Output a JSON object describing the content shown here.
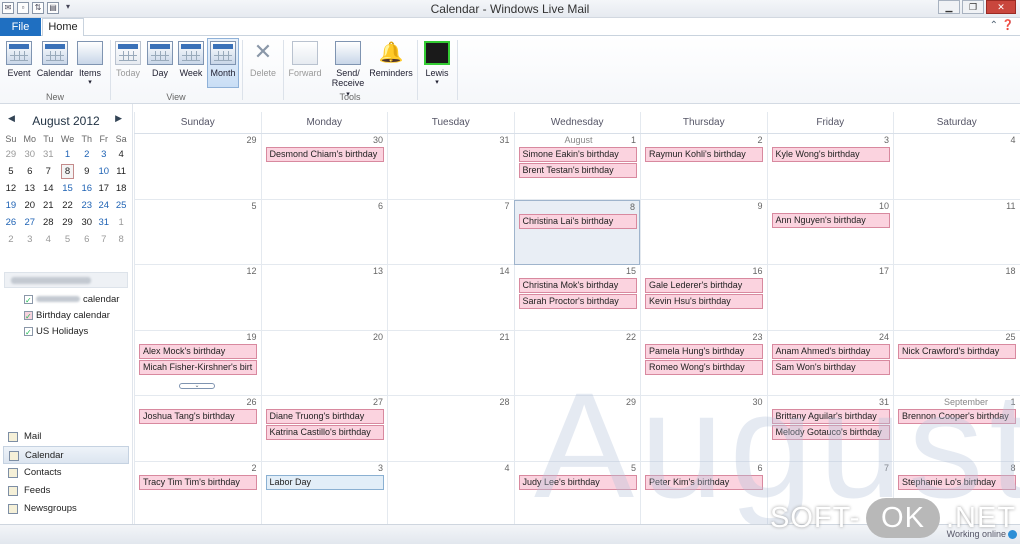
{
  "window": {
    "title": "Calendar - Windows Live Mail",
    "qat_icons": [
      "app-icon",
      "new-icon",
      "send-receive-icon",
      "print-icon",
      "customize-icon"
    ],
    "controls": [
      "minimize-icon",
      "restore-icon",
      "close-icon"
    ]
  },
  "ribbon": {
    "tabs": [
      {
        "label": "File",
        "active": false
      },
      {
        "label": "Home",
        "active": true
      }
    ],
    "groups": [
      {
        "label": "New",
        "buttons": [
          {
            "id": "event",
            "label": "Event",
            "icon": "event-icon",
            "enabled": true
          },
          {
            "id": "calendar",
            "label": "Calendar",
            "icon": "calendar-icon",
            "enabled": true
          },
          {
            "id": "items",
            "label": "Items",
            "icon": "items-icon",
            "enabled": true,
            "dropdown": true
          }
        ]
      },
      {
        "label": "View",
        "buttons": [
          {
            "id": "today",
            "label": "Today",
            "icon": "today-icon",
            "enabled": false
          },
          {
            "id": "day",
            "label": "Day",
            "icon": "day-view-icon",
            "enabled": true
          },
          {
            "id": "week",
            "label": "Week",
            "icon": "week-view-icon",
            "enabled": true
          },
          {
            "id": "month",
            "label": "Month",
            "icon": "month-view-icon",
            "enabled": true,
            "selected": true
          }
        ]
      },
      {
        "label": "",
        "buttons": [
          {
            "id": "delete",
            "label": "Delete",
            "icon": "delete-icon",
            "enabled": false
          }
        ]
      },
      {
        "label": "Tools",
        "buttons": [
          {
            "id": "forward",
            "label": "Forward",
            "icon": "forward-icon",
            "enabled": false
          },
          {
            "id": "sendreceive",
            "label": "Send/",
            "label2": "Receive",
            "icon": "send-receive-icon",
            "enabled": true,
            "dropdown": true
          },
          {
            "id": "reminders",
            "label": "Reminders",
            "icon": "bell-icon",
            "enabled": true
          }
        ]
      },
      {
        "label": "",
        "buttons": [
          {
            "id": "lewis",
            "label": "Lewis",
            "icon": "user-avatar-icon",
            "enabled": true,
            "dropdown": true
          }
        ]
      }
    ]
  },
  "mini_calendar": {
    "title": "August 2012",
    "weekdays": [
      "Su",
      "Mo",
      "Tu",
      "We",
      "Th",
      "Fr",
      "Sa"
    ],
    "weeks": [
      [
        {
          "d": "29",
          "o": true
        },
        {
          "d": "30",
          "o": true
        },
        {
          "d": "31",
          "o": true
        },
        {
          "d": "1",
          "b": true
        },
        {
          "d": "2",
          "b": true
        },
        {
          "d": "3",
          "b": true
        },
        {
          "d": "4"
        }
      ],
      [
        {
          "d": "5"
        },
        {
          "d": "6"
        },
        {
          "d": "7"
        },
        {
          "d": "8",
          "t": true
        },
        {
          "d": "9"
        },
        {
          "d": "10",
          "b": true
        },
        {
          "d": "11"
        }
      ],
      [
        {
          "d": "12"
        },
        {
          "d": "13"
        },
        {
          "d": "14"
        },
        {
          "d": "15",
          "b": true
        },
        {
          "d": "16",
          "b": true
        },
        {
          "d": "17"
        },
        {
          "d": "18"
        }
      ],
      [
        {
          "d": "19",
          "b": true
        },
        {
          "d": "20"
        },
        {
          "d": "21"
        },
        {
          "d": "22"
        },
        {
          "d": "23",
          "b": true
        },
        {
          "d": "24",
          "b": true
        },
        {
          "d": "25",
          "b": true
        }
      ],
      [
        {
          "d": "26",
          "b": true
        },
        {
          "d": "27",
          "b": true
        },
        {
          "d": "28"
        },
        {
          "d": "29"
        },
        {
          "d": "30"
        },
        {
          "d": "31",
          "b": true
        },
        {
          "d": "1",
          "o": true
        }
      ],
      [
        {
          "d": "2",
          "o": true
        },
        {
          "d": "3",
          "o": true
        },
        {
          "d": "4",
          "o": true
        },
        {
          "d": "5",
          "o": true
        },
        {
          "d": "6",
          "o": true
        },
        {
          "d": "7",
          "o": true
        },
        {
          "d": "8",
          "o": true
        }
      ]
    ]
  },
  "calendars": [
    {
      "label": "calendar",
      "blurred_prefix": true,
      "checked": true,
      "color": "#3a7fd5"
    },
    {
      "label": "Birthday calendar",
      "checked": true,
      "color": "#e88aa8"
    },
    {
      "label": "US Holidays",
      "checked": true,
      "color": "#6aa0d8"
    }
  ],
  "nav": [
    {
      "label": "Mail",
      "icon": "mail-icon",
      "selected": false
    },
    {
      "label": "Calendar",
      "icon": "calendar-icon",
      "selected": true
    },
    {
      "label": "Contacts",
      "icon": "contacts-icon",
      "selected": false
    },
    {
      "label": "Feeds",
      "icon": "rss-feed-icon",
      "selected": false
    },
    {
      "label": "Newsgroups",
      "icon": "newsgroups-icon",
      "selected": false
    }
  ],
  "month_view": {
    "weekdays": [
      "Sunday",
      "Monday",
      "Tuesday",
      "Wednesday",
      "Thursday",
      "Friday",
      "Saturday"
    ],
    "watermark": "August",
    "weeks": [
      [
        {
          "d": "29",
          "events": []
        },
        {
          "d": "30",
          "events": [
            "Desmond Chiam's birthday"
          ]
        },
        {
          "d": "31",
          "events": []
        },
        {
          "d": "1",
          "month": "August",
          "events": [
            "Simone Eakin's birthday",
            "Brent Testan's birthday"
          ]
        },
        {
          "d": "2",
          "events": [
            "Raymun Kohli's birthday"
          ]
        },
        {
          "d": "3",
          "events": [
            "Kyle Wong's birthday"
          ]
        },
        {
          "d": "4",
          "events": []
        }
      ],
      [
        {
          "d": "5",
          "events": []
        },
        {
          "d": "6",
          "events": []
        },
        {
          "d": "7",
          "events": []
        },
        {
          "d": "8",
          "today": true,
          "events": [
            "Christina Lai's birthday"
          ]
        },
        {
          "d": "9",
          "events": []
        },
        {
          "d": "10",
          "events": [
            "Ann Nguyen's birthday"
          ]
        },
        {
          "d": "11",
          "events": []
        }
      ],
      [
        {
          "d": "12",
          "events": []
        },
        {
          "d": "13",
          "events": []
        },
        {
          "d": "14",
          "events": []
        },
        {
          "d": "15",
          "events": [
            "Christina Mok's birthday",
            "Sarah Proctor's birthday"
          ]
        },
        {
          "d": "16",
          "events": [
            "Gale Lederer's birthday",
            "Kevin Hsu's birthday"
          ]
        },
        {
          "d": "17",
          "events": []
        },
        {
          "d": "18",
          "events": []
        }
      ],
      [
        {
          "d": "19",
          "more": true,
          "events": [
            "Alex Mock's birthday",
            "Micah Fisher-Kirshner's birt"
          ]
        },
        {
          "d": "20",
          "events": []
        },
        {
          "d": "21",
          "events": []
        },
        {
          "d": "22",
          "events": []
        },
        {
          "d": "23",
          "events": [
            "Pamela Hung's birthday",
            "Romeo Wong's birthday"
          ]
        },
        {
          "d": "24",
          "events": [
            "Anam Ahmed's birthday",
            "Sam Won's birthday"
          ]
        },
        {
          "d": "25",
          "events": [
            "Nick Crawford's birthday"
          ]
        }
      ],
      [
        {
          "d": "26",
          "events": [
            "Joshua Tang's birthday"
          ]
        },
        {
          "d": "27",
          "events": [
            "Diane Truong's birthday",
            "Katrina Castillo's birthday"
          ]
        },
        {
          "d": "28",
          "events": []
        },
        {
          "d": "29",
          "events": []
        },
        {
          "d": "30",
          "events": []
        },
        {
          "d": "31",
          "events": [
            "Brittany Aguilar's birthday",
            "Melody Gotauco's birthday"
          ]
        },
        {
          "d": "1",
          "month": "September",
          "events": [
            "Brennon Cooper's birthday"
          ]
        }
      ],
      [
        {
          "d": "2",
          "events": [
            "Tracy Tim Tim's birthday"
          ]
        },
        {
          "d": "3",
          "holiday": true,
          "events": [
            "Labor Day"
          ]
        },
        {
          "d": "4",
          "events": []
        },
        {
          "d": "5",
          "events": [
            "Judy Lee's birthday"
          ]
        },
        {
          "d": "6",
          "events": [
            "Peter Kim's birthday"
          ]
        },
        {
          "d": "7",
          "events": []
        },
        {
          "d": "8",
          "events": [
            "Stephanie Lo's birthday"
          ]
        }
      ]
    ]
  },
  "status": {
    "text": "Working online",
    "icon": "globe-icon"
  },
  "overlay": {
    "left": "SOFT-",
    "mid": "OK",
    "right": ".NET"
  }
}
